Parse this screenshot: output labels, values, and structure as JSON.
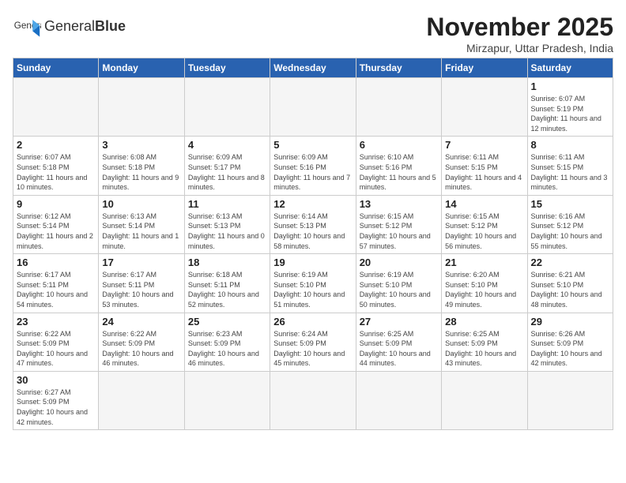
{
  "logo": {
    "text_normal": "General",
    "text_bold": "Blue"
  },
  "title": "November 2025",
  "subtitle": "Mirzapur, Uttar Pradesh, India",
  "headers": [
    "Sunday",
    "Monday",
    "Tuesday",
    "Wednesday",
    "Thursday",
    "Friday",
    "Saturday"
  ],
  "weeks": [
    [
      {
        "day": "",
        "info": ""
      },
      {
        "day": "",
        "info": ""
      },
      {
        "day": "",
        "info": ""
      },
      {
        "day": "",
        "info": ""
      },
      {
        "day": "",
        "info": ""
      },
      {
        "day": "",
        "info": ""
      },
      {
        "day": "1",
        "info": "Sunrise: 6:07 AM\nSunset: 5:19 PM\nDaylight: 11 hours\nand 12 minutes."
      }
    ],
    [
      {
        "day": "2",
        "info": "Sunrise: 6:07 AM\nSunset: 5:18 PM\nDaylight: 11 hours\nand 10 minutes."
      },
      {
        "day": "3",
        "info": "Sunrise: 6:08 AM\nSunset: 5:18 PM\nDaylight: 11 hours\nand 9 minutes."
      },
      {
        "day": "4",
        "info": "Sunrise: 6:09 AM\nSunset: 5:17 PM\nDaylight: 11 hours\nand 8 minutes."
      },
      {
        "day": "5",
        "info": "Sunrise: 6:09 AM\nSunset: 5:16 PM\nDaylight: 11 hours\nand 7 minutes."
      },
      {
        "day": "6",
        "info": "Sunrise: 6:10 AM\nSunset: 5:16 PM\nDaylight: 11 hours\nand 5 minutes."
      },
      {
        "day": "7",
        "info": "Sunrise: 6:11 AM\nSunset: 5:15 PM\nDaylight: 11 hours\nand 4 minutes."
      },
      {
        "day": "8",
        "info": "Sunrise: 6:11 AM\nSunset: 5:15 PM\nDaylight: 11 hours\nand 3 minutes."
      }
    ],
    [
      {
        "day": "9",
        "info": "Sunrise: 6:12 AM\nSunset: 5:14 PM\nDaylight: 11 hours\nand 2 minutes."
      },
      {
        "day": "10",
        "info": "Sunrise: 6:13 AM\nSunset: 5:14 PM\nDaylight: 11 hours\nand 1 minute."
      },
      {
        "day": "11",
        "info": "Sunrise: 6:13 AM\nSunset: 5:13 PM\nDaylight: 11 hours\nand 0 minutes."
      },
      {
        "day": "12",
        "info": "Sunrise: 6:14 AM\nSunset: 5:13 PM\nDaylight: 10 hours\nand 58 minutes."
      },
      {
        "day": "13",
        "info": "Sunrise: 6:15 AM\nSunset: 5:12 PM\nDaylight: 10 hours\nand 57 minutes."
      },
      {
        "day": "14",
        "info": "Sunrise: 6:15 AM\nSunset: 5:12 PM\nDaylight: 10 hours\nand 56 minutes."
      },
      {
        "day": "15",
        "info": "Sunrise: 6:16 AM\nSunset: 5:12 PM\nDaylight: 10 hours\nand 55 minutes."
      }
    ],
    [
      {
        "day": "16",
        "info": "Sunrise: 6:17 AM\nSunset: 5:11 PM\nDaylight: 10 hours\nand 54 minutes."
      },
      {
        "day": "17",
        "info": "Sunrise: 6:17 AM\nSunset: 5:11 PM\nDaylight: 10 hours\nand 53 minutes."
      },
      {
        "day": "18",
        "info": "Sunrise: 6:18 AM\nSunset: 5:11 PM\nDaylight: 10 hours\nand 52 minutes."
      },
      {
        "day": "19",
        "info": "Sunrise: 6:19 AM\nSunset: 5:10 PM\nDaylight: 10 hours\nand 51 minutes."
      },
      {
        "day": "20",
        "info": "Sunrise: 6:19 AM\nSunset: 5:10 PM\nDaylight: 10 hours\nand 50 minutes."
      },
      {
        "day": "21",
        "info": "Sunrise: 6:20 AM\nSunset: 5:10 PM\nDaylight: 10 hours\nand 49 minutes."
      },
      {
        "day": "22",
        "info": "Sunrise: 6:21 AM\nSunset: 5:10 PM\nDaylight: 10 hours\nand 48 minutes."
      }
    ],
    [
      {
        "day": "23",
        "info": "Sunrise: 6:22 AM\nSunset: 5:09 PM\nDaylight: 10 hours\nand 47 minutes."
      },
      {
        "day": "24",
        "info": "Sunrise: 6:22 AM\nSunset: 5:09 PM\nDaylight: 10 hours\nand 46 minutes."
      },
      {
        "day": "25",
        "info": "Sunrise: 6:23 AM\nSunset: 5:09 PM\nDaylight: 10 hours\nand 46 minutes."
      },
      {
        "day": "26",
        "info": "Sunrise: 6:24 AM\nSunset: 5:09 PM\nDaylight: 10 hours\nand 45 minutes."
      },
      {
        "day": "27",
        "info": "Sunrise: 6:25 AM\nSunset: 5:09 PM\nDaylight: 10 hours\nand 44 minutes."
      },
      {
        "day": "28",
        "info": "Sunrise: 6:25 AM\nSunset: 5:09 PM\nDaylight: 10 hours\nand 43 minutes."
      },
      {
        "day": "29",
        "info": "Sunrise: 6:26 AM\nSunset: 5:09 PM\nDaylight: 10 hours\nand 42 minutes."
      }
    ],
    [
      {
        "day": "30",
        "info": "Sunrise: 6:27 AM\nSunset: 5:09 PM\nDaylight: 10 hours\nand 42 minutes."
      },
      {
        "day": "",
        "info": ""
      },
      {
        "day": "",
        "info": ""
      },
      {
        "day": "",
        "info": ""
      },
      {
        "day": "",
        "info": ""
      },
      {
        "day": "",
        "info": ""
      },
      {
        "day": "",
        "info": ""
      }
    ]
  ]
}
